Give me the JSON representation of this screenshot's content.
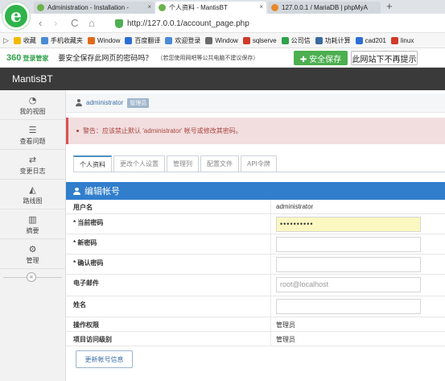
{
  "browser": {
    "logo_letter": "e",
    "tabs": [
      {
        "title": "Administration - Installation -",
        "active": false
      },
      {
        "title": "个人资料 - MantisBT",
        "active": true
      },
      {
        "title": "127.0.0.1 / MariaDB | phpMyA",
        "active": false
      }
    ],
    "close_glyph": "×",
    "new_tab_glyph": "+",
    "nav": {
      "back": "‹",
      "forward": "›",
      "reload": "C",
      "home": "⌂"
    },
    "url": "http://127.0.0.1/account_page.php"
  },
  "bookmarks": {
    "panel_glyph": "▷",
    "items": [
      {
        "label": "收藏",
        "color": "#f3b900"
      },
      {
        "label": "手机收藏夹",
        "color": "#4a8ad6"
      },
      {
        "label": "Window",
        "color": "#e06a1a"
      },
      {
        "label": "百度翻译",
        "color": "#2b6fd6"
      },
      {
        "label": "欢迎登录",
        "color": "#4a8ad6"
      },
      {
        "label": "Window",
        "color": "#6a6a6a"
      },
      {
        "label": "sqlserve",
        "color": "#d03a2a"
      },
      {
        "label": "公司信",
        "color": "#2fa34a"
      },
      {
        "label": "功耗计算",
        "color": "#3b6aa0"
      },
      {
        "label": "cad201",
        "color": "#2b6fd6"
      },
      {
        "label": "linux",
        "color": "#d03a2a"
      }
    ]
  },
  "password_prompt": {
    "brand": "360",
    "brand_sub": "登录管家",
    "question": "要安全保存此网页的密码吗？",
    "note": "（若您使用网吧等公共电脑不建议保存）",
    "save_label": "✚ 安全保存",
    "never_label": "此网站下不再提示"
  },
  "app": {
    "name": "MantisBT"
  },
  "sidebar": {
    "collapse_glyph": "«",
    "items": [
      {
        "label": "我的视图",
        "glyph": "◔"
      },
      {
        "label": "查看问题",
        "glyph": "☰"
      },
      {
        "label": "变更日志",
        "glyph": "⇄"
      },
      {
        "label": "路线图",
        "glyph": "◭"
      },
      {
        "label": "摘要",
        "glyph": "▥"
      },
      {
        "label": "管理",
        "glyph": "⚙"
      }
    ]
  },
  "breadcrumb": {
    "user": "administrator",
    "badge": "管理员"
  },
  "alert": {
    "text": "警告：应该禁止默认 'administrator' 帐号或修改其密码。"
  },
  "tabs": [
    "个人资料",
    "更改个人设置",
    "管理列",
    "配置文件",
    "API令牌"
  ],
  "panel": {
    "title": "编辑帐号",
    "rows": [
      {
        "label": "用户名",
        "value": "administrator"
      },
      {
        "label": "* 当前密码",
        "input": "••••••••••"
      },
      {
        "label": "* 新密码",
        "input": ""
      },
      {
        "label": "* 确认密码",
        "input": ""
      },
      {
        "label": "电子邮件",
        "input": "root@localhost"
      },
      {
        "label": "姓名",
        "input": ""
      },
      {
        "label": "操作权限",
        "value": "管理员"
      },
      {
        "label": "项目访问级别",
        "value": "管理员"
      }
    ],
    "submit_label": "更新帐号信息"
  }
}
